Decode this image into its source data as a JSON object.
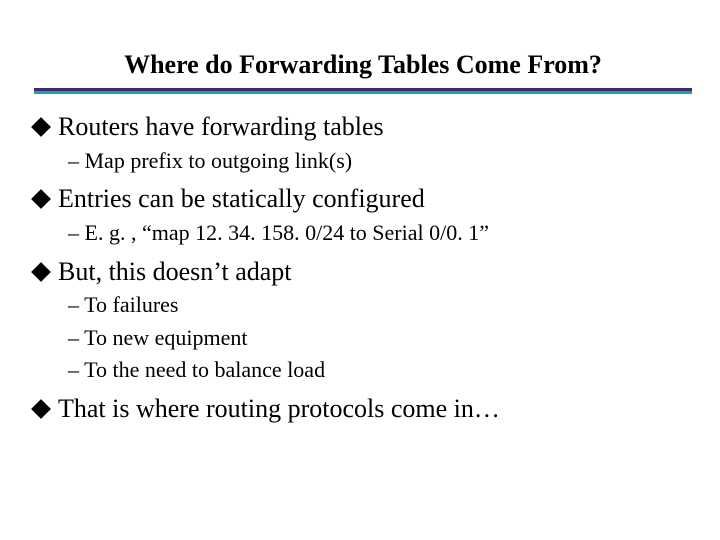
{
  "title": "Where do Forwarding Tables Come From?",
  "bullets": [
    {
      "text": "Routers have forwarding tables",
      "sub": [
        "– Map prefix to outgoing link(s)"
      ]
    },
    {
      "text": "Entries can be statically configured",
      "sub": [
        "– E. g. , “map 12. 34. 158. 0/24 to Serial 0/0. 1”"
      ]
    },
    {
      "text": "But, this doesn’t adapt",
      "sub": [
        "– To failures",
        "– To new equipment",
        "– To the need to balance load"
      ]
    },
    {
      "text": "That is where routing protocols come in…",
      "sub": []
    }
  ]
}
